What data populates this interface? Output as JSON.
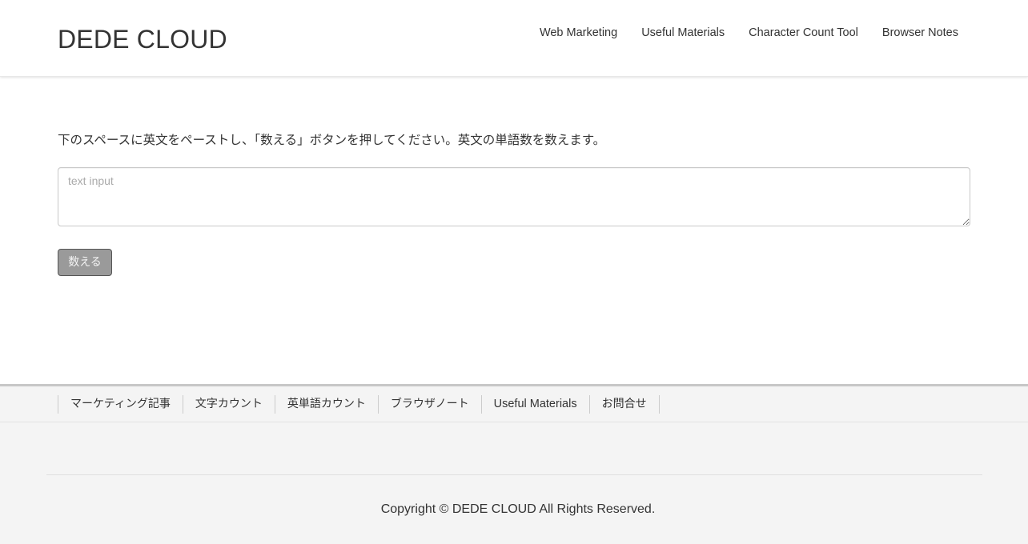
{
  "header": {
    "site_title": "DEDE CLOUD",
    "nav": [
      "Web Marketing",
      "Useful Materials",
      "Character Count Tool",
      "Browser Notes"
    ]
  },
  "main": {
    "instruction": "下のスペースに英文をペーストし、「数える」ボタンを押してください。英文の単語数を数えます。",
    "textarea": {
      "placeholder": "text input",
      "value": ""
    },
    "count_button_label": "数える"
  },
  "footer": {
    "nav": [
      "マーケティング記事",
      "文字カウント",
      "英単語カウント",
      "ブラウザノート",
      "Useful Materials",
      "お問合せ"
    ],
    "copyright": "Copyright © DEDE CLOUD All Rights Reserved."
  },
  "colors": {
    "button_background": "#9a9a9a",
    "footer_background": "#f4f4f4",
    "text": "#333333"
  }
}
